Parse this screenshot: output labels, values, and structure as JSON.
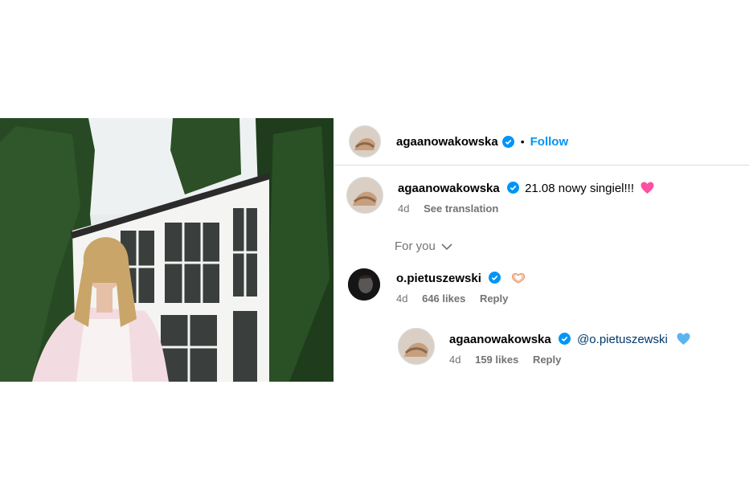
{
  "header": {
    "username": "agaanowakowska",
    "separator": "•",
    "follow_label": "Follow"
  },
  "caption": {
    "username": "agaanowakowska",
    "text": "21.08 nowy singiel!!!",
    "emoji": "pink-heart",
    "time": "4d",
    "translate_label": "See translation"
  },
  "sort": {
    "label": "For you"
  },
  "comments": [
    {
      "username": "o.pietuszewski",
      "text": "",
      "emoji": "heart-hands",
      "time": "4d",
      "likes": "646 likes",
      "reply_label": "Reply"
    },
    {
      "username": "agaanowakowska",
      "mention": "@o.pietuszewski",
      "emoji": "blue-heart",
      "time": "4d",
      "likes": "159 likes",
      "reply_label": "Reply"
    }
  ],
  "colors": {
    "follow": "#0095f6",
    "verified": "#0095f6",
    "muted": "#737373",
    "mention": "#00376b",
    "divider": "#dbdbdb"
  }
}
